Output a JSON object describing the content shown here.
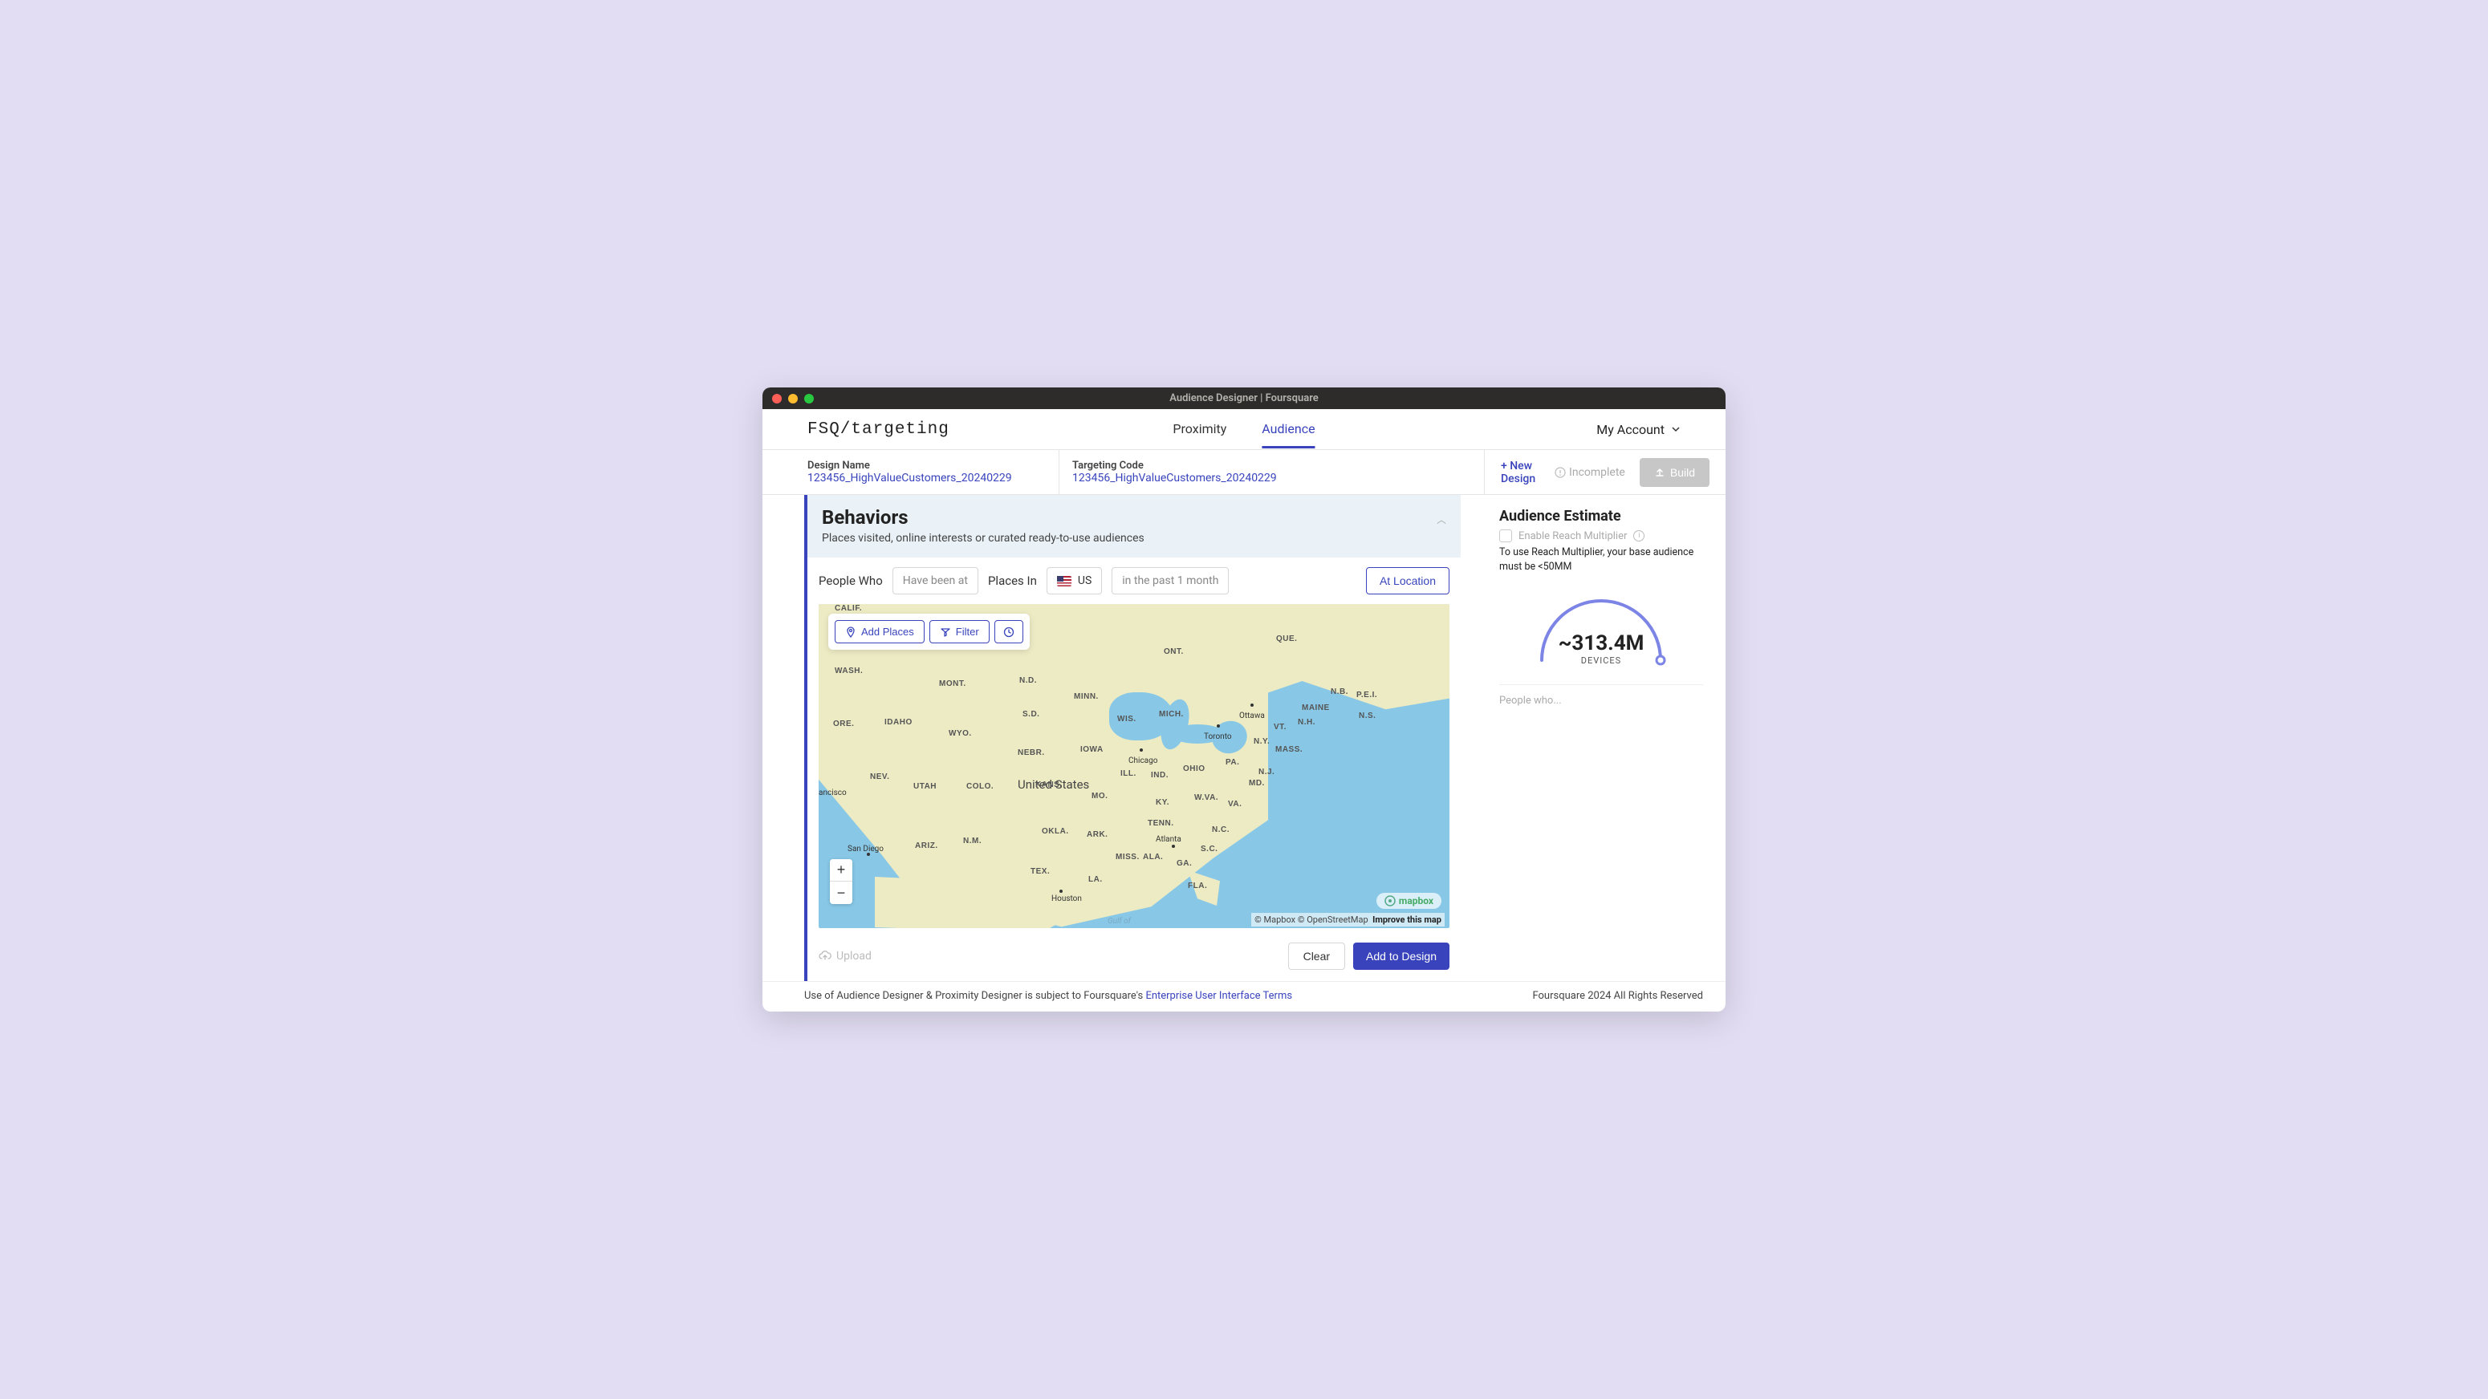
{
  "window": {
    "title": "Audience Designer | Foursquare"
  },
  "logo": "FSQ/targeting",
  "nav": {
    "tabs": [
      {
        "label": "Proximity"
      },
      {
        "label": "Audience"
      }
    ],
    "account": "My Account"
  },
  "subheader": {
    "design_label": "Design Name",
    "design_value": "123456_HighValueCustomers_20240229",
    "code_label": "Targeting Code",
    "code_value": "123456_HighValueCustomers_20240229",
    "new_design": "+ New Design",
    "incomplete": "Incomplete",
    "build": "Build"
  },
  "behaviors": {
    "title": "Behaviors",
    "subtitle": "Places visited, online interests or curated ready-to-use audiences"
  },
  "builder": {
    "people_who": "People Who",
    "have_been": "Have been at",
    "places_in": "Places In",
    "country": "US",
    "time_range": "in the past 1 month",
    "at_location": "At Location"
  },
  "map_controls": {
    "add_places": "Add Places",
    "filter": "Filter"
  },
  "map": {
    "country_label": "United States",
    "states": [
      "WASH.",
      "MONT.",
      "N.D.",
      "S.D.",
      "MINN.",
      "WIS.",
      "MICH.",
      "ONT.",
      "QUE.",
      "N.B.",
      "P.E.I.",
      "MAINE",
      "N.S.",
      "N.H.",
      "VT.",
      "N.Y.",
      "MASS.",
      "PA.",
      "N.J.",
      "MD.",
      "OHIO",
      "IND.",
      "ILL.",
      "IOWA",
      "NEBR.",
      "WYO.",
      "IDAHO",
      "ORE.",
      "CALIF.",
      "NEV.",
      "UTAH",
      "COLO.",
      "KANS.",
      "MO.",
      "KY.",
      "W.VA.",
      "VA.",
      "TENN.",
      "N.C.",
      "S.C.",
      "ARK.",
      "OKLA.",
      "N.M.",
      "ARIZ.",
      "TEX.",
      "LA.",
      "MISS.",
      "ALA.",
      "GA.",
      "FLA."
    ],
    "cities": [
      {
        "name": "Ottawa"
      },
      {
        "name": "Toronto"
      },
      {
        "name": "Chicago"
      },
      {
        "name": "Atlanta"
      },
      {
        "name": "Houston"
      },
      {
        "name": "San Diego"
      },
      {
        "name": "ancisco"
      }
    ],
    "sea": "Gulf of",
    "logo": "mapbox",
    "attrib_mapbox": "© Mapbox",
    "attrib_osm": "© OpenStreetMap",
    "improve": "Improve this map"
  },
  "zoom": {
    "in": "+",
    "out": "−"
  },
  "actions": {
    "upload": "Upload",
    "clear": "Clear",
    "add": "Add to Design"
  },
  "estimate": {
    "title": "Audience Estimate",
    "reach_label": "Enable Reach Multiplier",
    "note": "To use Reach Multiplier, your base audience must be <50MM",
    "value": "~313.4M",
    "unit": "DEVICES",
    "people_who": "People who..."
  },
  "footer": {
    "prefix": "Use of Audience Designer & Proximity Designer is subject to Foursquare's ",
    "link": "Enterprise User Interface Terms",
    "copyright": "Foursquare 2024 All Rights Reserved"
  }
}
